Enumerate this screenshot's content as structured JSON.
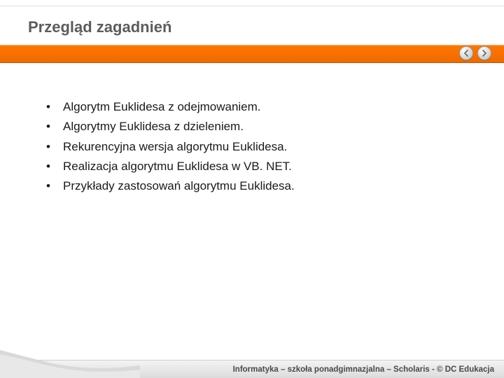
{
  "title": "Przegląd zagadnień",
  "bullets": [
    "Algorytm Euklidesa z odejmowaniem.",
    "Algorytmy Euklidesa z dzieleniem.",
    "Rekurencyjna wersja algorytmu Euklidesa.",
    "Realizacja algorytmu Euklidesa w VB. NET.",
    "Przykłady zastosowań algorytmu Euklidesa."
  ],
  "footer": "Informatyka – szkoła ponadgimnazjalna – Scholaris - © DC Edukacja",
  "nav": {
    "prev": "previous",
    "next": "next"
  }
}
